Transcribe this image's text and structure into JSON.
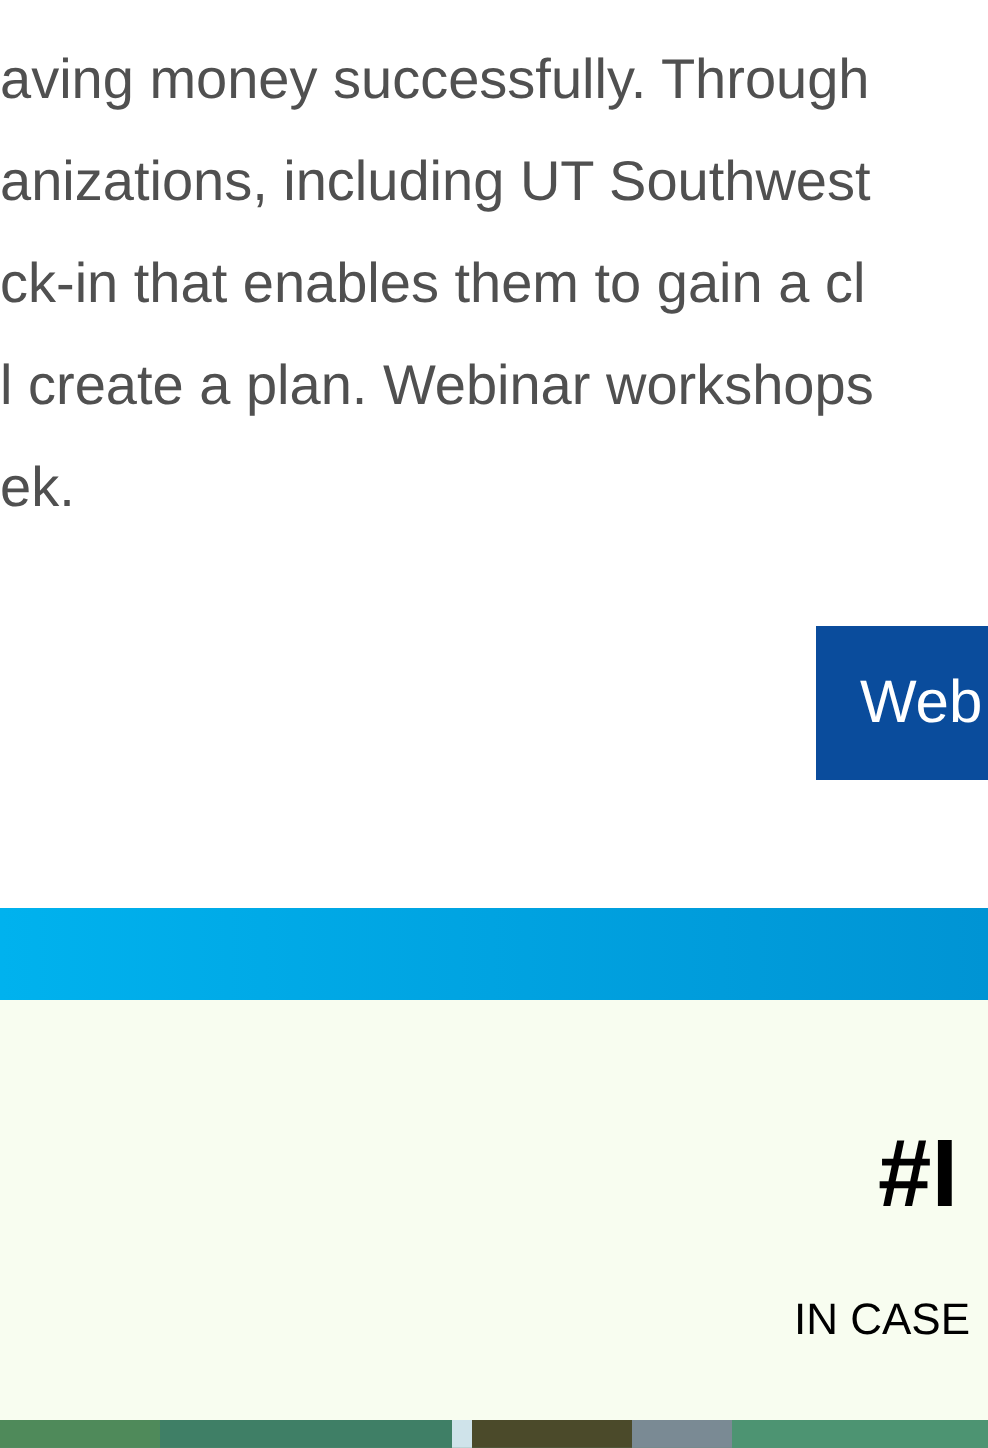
{
  "paragraph": {
    "lines": [
      "aving money successfully. Through",
      "anizations, including UT Southwest",
      "ck-in that enables them to gain a cl",
      "l create a plan. Webinar workshops",
      "ek."
    ]
  },
  "button": {
    "label": "Web"
  },
  "section": {
    "heading": "#I",
    "subheading": "IN CASE"
  }
}
